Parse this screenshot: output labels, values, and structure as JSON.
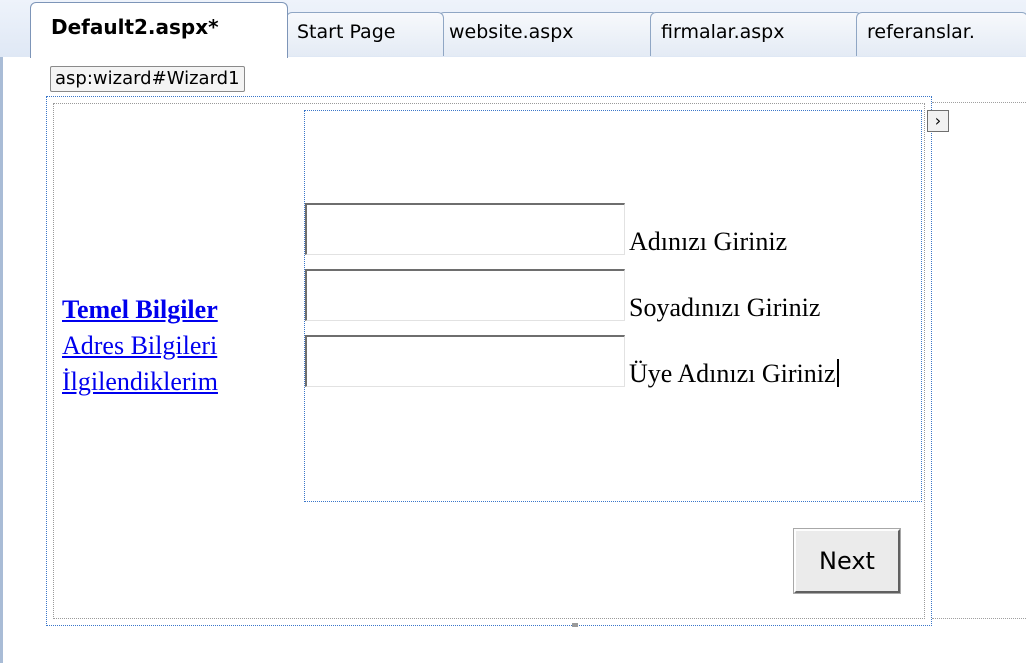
{
  "tabs": [
    {
      "label": "Default2.aspx*",
      "active": true
    },
    {
      "label": "Start Page",
      "active": false
    },
    {
      "label": "website.aspx",
      "active": false
    },
    {
      "label": "firmalar.aspx",
      "active": false
    },
    {
      "label": "referanslar.",
      "active": false
    }
  ],
  "designer": {
    "control_tag": "asp:wizard#Wizard1",
    "smart_tag_glyph": "›"
  },
  "wizard": {
    "sidebar": [
      {
        "label": "Temel Bilgiler",
        "current": true
      },
      {
        "label": "Adres Bilgileri",
        "current": false
      },
      {
        "label": "İlgilendiklerim",
        "current": false
      }
    ],
    "fields": [
      {
        "label": "Adınızı Giriniz",
        "value": ""
      },
      {
        "label": "Soyadınızı Giriniz",
        "value": ""
      },
      {
        "label": "Üye Adınızı Giriniz",
        "value": ""
      }
    ],
    "next_label": "Next"
  },
  "colors": {
    "link": "#0000ee",
    "selection_border": "#3a76c9",
    "tab_border": "#8fa6c4"
  }
}
